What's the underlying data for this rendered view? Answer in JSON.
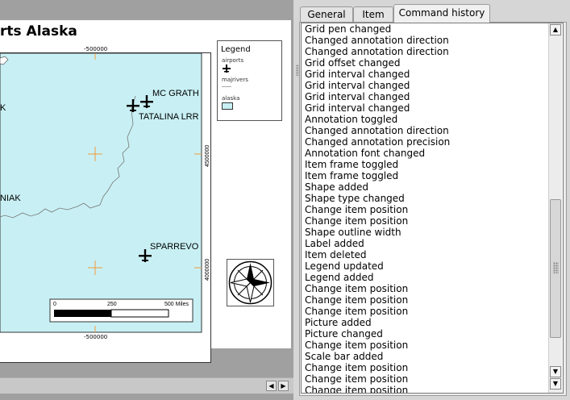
{
  "map": {
    "title": "rts Alaska",
    "top_coord": "-500000",
    "bottom_coord": "-500000",
    "right_coord_1": "4500000",
    "right_coord_2": "4000000",
    "place_labels": [
      "MC GRATH",
      "TATALINA LRR",
      "SPARREVO",
      "NIAK",
      "K"
    ],
    "scalebar": {
      "l0": "0",
      "l1": "250",
      "l2": "500 Miles"
    },
    "colors": {
      "land": "#c8f0f4",
      "border": "#333333",
      "grid": "#f29a3a"
    }
  },
  "legend": {
    "title": "Legend",
    "items": [
      {
        "label": "airports",
        "symbol": "plane-icon"
      },
      {
        "label": "majrivers",
        "symbol": "line"
      },
      {
        "label": "alaska",
        "symbol": "swatch"
      }
    ]
  },
  "tabs": [
    {
      "label": "General",
      "active": false
    },
    {
      "label": "Item",
      "active": false
    },
    {
      "label": "Command history",
      "active": true
    }
  ],
  "history": [
    "Grid pen changed",
    "Changed annotation direction",
    "Changed annotation direction",
    "Grid offset changed",
    "Grid interval changed",
    "Grid interval changed",
    "Grid interval changed",
    "Grid interval changed",
    "Annotation toggled",
    "Changed annotation direction",
    "Changed annotation precision",
    "Annotation font changed",
    "Item frame toggled",
    "Item frame toggled",
    "Shape added",
    "Shape type changed",
    "Change item position",
    "Change item position",
    "Shape outline width",
    "Label added",
    "Item deleted",
    "Legend updated",
    "Legend added",
    "Change item position",
    "Change item position",
    "Change item position",
    "Picture added",
    "Picture changed",
    "Change item position",
    "Scale bar added",
    "Change item position",
    "Change item position",
    "Change item position"
  ]
}
